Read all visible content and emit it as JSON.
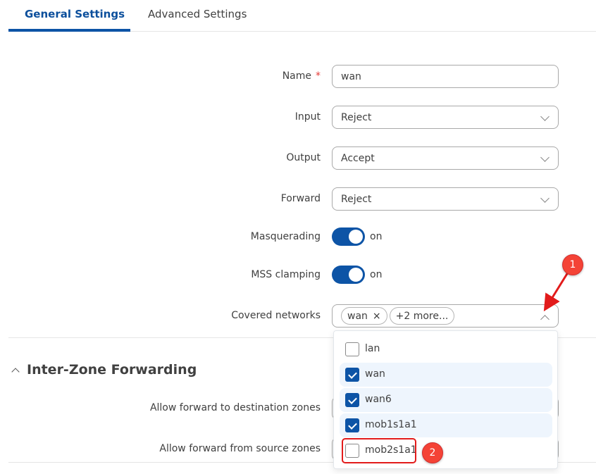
{
  "tabs": [
    {
      "label": "General Settings",
      "active": true
    },
    {
      "label": "Advanced Settings",
      "active": false
    }
  ],
  "form": {
    "name": {
      "label": "Name",
      "required_mark": "*",
      "value": "wan"
    },
    "input": {
      "label": "Input",
      "value": "Reject"
    },
    "output": {
      "label": "Output",
      "value": "Accept"
    },
    "forward": {
      "label": "Forward",
      "value": "Reject"
    },
    "masquerading": {
      "label": "Masquerading",
      "state": "on"
    },
    "mss_clamping": {
      "label": "MSS clamping",
      "state": "on"
    },
    "covered_networks": {
      "label": "Covered networks",
      "chips": [
        {
          "label": "wan",
          "remove_icon": "×"
        }
      ],
      "more_chip": "+2 more..."
    }
  },
  "dropdown": {
    "options": [
      {
        "label": "lan",
        "checked": false
      },
      {
        "label": "wan",
        "checked": true
      },
      {
        "label": "wan6",
        "checked": true
      },
      {
        "label": "mob1s1a1",
        "checked": true
      },
      {
        "label": "mob2s1a1",
        "checked": false
      }
    ]
  },
  "section": {
    "title": "Inter-Zone Forwarding",
    "fields": [
      {
        "label": "Allow forward to destination zones"
      },
      {
        "label": "Allow forward from source zones"
      }
    ]
  },
  "annotations": {
    "badge1": "1",
    "badge2": "2",
    "accent_color": "#0d54a6",
    "annotation_color": "#e21b1b"
  }
}
